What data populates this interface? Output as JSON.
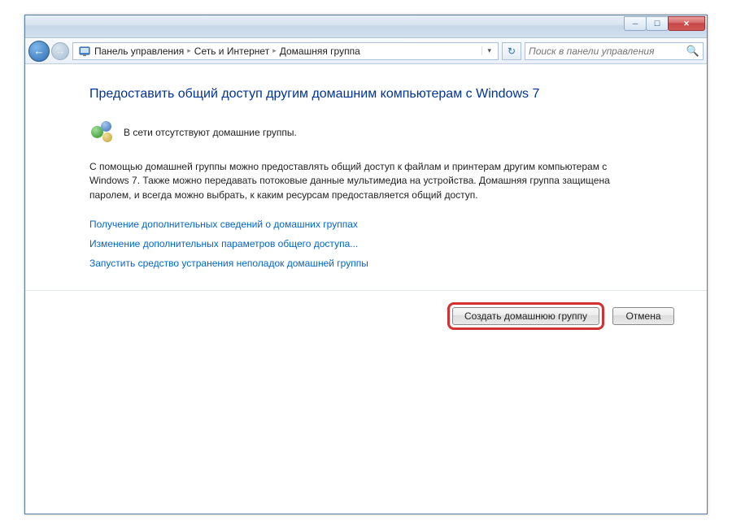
{
  "window": {
    "minimize": "─",
    "maximize": "☐",
    "close": "✕"
  },
  "nav": {
    "back_glyph": "←",
    "fwd_glyph": "→",
    "refresh_glyph": "↻",
    "search_glyph": "🔍"
  },
  "breadcrumb": {
    "item1": "Панель управления",
    "item2": "Сеть и Интернет",
    "item3": "Домашняя группа",
    "sep": "▸",
    "dropdown": "▾"
  },
  "search": {
    "placeholder": "Поиск в панели управления"
  },
  "page": {
    "title": "Предоставить общий доступ другим домашним компьютерам с Windows 7",
    "status": "В сети отсутствуют домашние группы.",
    "description": "С помощью домашней группы можно предоставлять общий доступ к файлам и принтерам другим компьютерам с Windows 7. Также можно передавать потоковые данные мультимедиа на устройства. Домашняя группа защищена паролем, и всегда можно выбрать, к каким ресурсам предоставляется общий доступ.",
    "links": [
      "Получение дополнительных сведений о домашних группах",
      "Изменение дополнительных параметров общего доступа...",
      "Запустить средство устранения неполадок домашней группы"
    ]
  },
  "buttons": {
    "create": "Создать домашнюю группу",
    "cancel": "Отмена"
  }
}
